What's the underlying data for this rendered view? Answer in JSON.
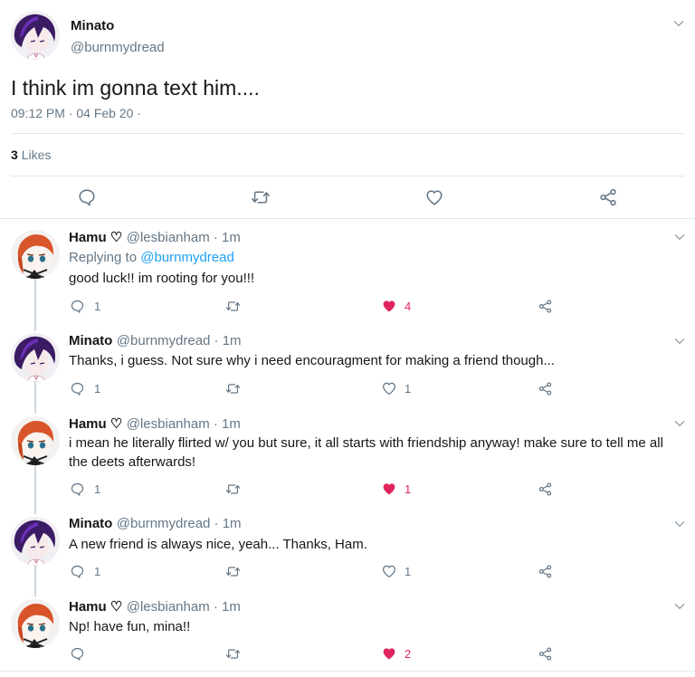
{
  "main_tweet": {
    "name": "Minato",
    "handle": "@burnmydread",
    "text": "I think im gonna text him....",
    "timestamp": "09:12 PM · 04 Feb 20 ·",
    "likes_count": "3",
    "likes_label": "Likes"
  },
  "replies": [
    {
      "name": "Hamu ♡",
      "handle": "@lesbianham · 1m",
      "replying_prefix": "Replying to ",
      "replying_to": "@burnmydread",
      "text": "good luck!! im rooting for you!!!",
      "reply_count": "1",
      "like_count": "4",
      "liked": true
    },
    {
      "name": "Minato",
      "handle": "@burnmydread · 1m",
      "text": "Thanks, i guess. Not sure why i need encouragment for making a friend though...",
      "reply_count": "1",
      "like_count": "1",
      "liked": false
    },
    {
      "name": "Hamu ♡",
      "handle": "@lesbianham · 1m",
      "text_line1": "i mean he literally flirted w/ you but sure, it all starts with friendship anyway! make sure to tell me all",
      "text_line2": "the deets afterwards!",
      "reply_count": "1",
      "like_count": "1",
      "liked": true
    },
    {
      "name": "Minato",
      "handle": "@burnmydread · 1m",
      "text": "A new friend is always nice, yeah... Thanks, Ham.",
      "reply_count": "1",
      "like_count": "1",
      "liked": false
    },
    {
      "name": "Hamu ♡",
      "handle": "@lesbianham · 1m",
      "text": "Np! have fun, mina!!",
      "reply_count": "",
      "like_count": "2",
      "liked": true
    }
  ],
  "icons": {
    "reply": "comment-bubble-icon",
    "retweet": "retweet-icon",
    "like": "heart-icon",
    "share": "share-icon",
    "more": "chevron-down-icon"
  },
  "colors": {
    "liked": "#e0245e",
    "link": "#1da1f2",
    "muted": "#657786"
  }
}
